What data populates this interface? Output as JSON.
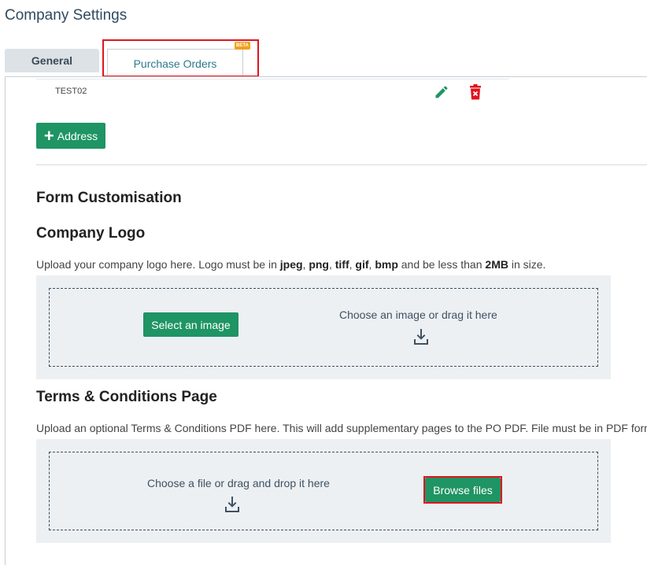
{
  "page": {
    "title": "Company Settings"
  },
  "tabs": [
    {
      "label": "General",
      "active": false
    },
    {
      "label": "Purchase Orders",
      "active": true,
      "badge": "BETA"
    }
  ],
  "addresses": [
    {
      "name": "TEST02"
    }
  ],
  "buttons": {
    "add_address": "Address",
    "select_image": "Select an image",
    "browse_files": "Browse files"
  },
  "form_customisation": {
    "title": "Form Customisation",
    "logo": {
      "title": "Company Logo",
      "desc_prefix": "Upload your company logo here. Logo must be in ",
      "formats": [
        "jpeg",
        "png",
        "tiff",
        "gif",
        "bmp"
      ],
      "desc_mid": " and be less than ",
      "size_limit": "2MB",
      "desc_suffix": " in size.",
      "drop_text": "Choose an image or drag it here"
    },
    "terms": {
      "title": "Terms & Conditions Page",
      "desc": "Upload an optional Terms & Conditions PDF here. This will add supplementary pages to the PO PDF. File must be in PDF forma",
      "drop_text": "Choose a file or drag and drop it here"
    }
  },
  "colors": {
    "accent_green": "#1f9464",
    "delete_red": "#e0141e",
    "highlight_red": "#e0141e",
    "beta_orange": "#f0a020"
  },
  "icons": {
    "edit": "pencil-icon",
    "delete": "trash-icon",
    "add": "plus-icon",
    "download": "download-icon"
  }
}
